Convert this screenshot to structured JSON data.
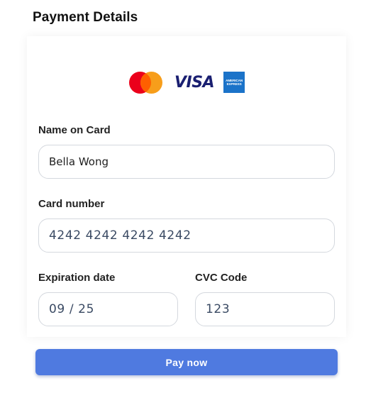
{
  "page": {
    "title": "Payment Details"
  },
  "card_brands": [
    {
      "name": "Mastercard",
      "icon": "mastercard-logo-icon"
    },
    {
      "name": "VISA",
      "icon": "visa-logo-icon",
      "color": "#1a1f71"
    },
    {
      "name": "American Express",
      "icon": "amex-logo-icon",
      "color": "#1b73c9"
    }
  ],
  "amex_lines": [
    "AMERICAN",
    "EXPRESS"
  ],
  "form": {
    "name": {
      "label": "Name on Card",
      "value": "Bella Wong"
    },
    "card_number": {
      "label": "Card number",
      "value": "4242 4242 4242 4242"
    },
    "expiration": {
      "label": "Expiration date",
      "value": "09 / 25"
    },
    "cvc": {
      "label": "CVC Code",
      "value": "123"
    }
  },
  "pay_button": {
    "label": "Pay now",
    "color": "#4f7ae0"
  }
}
